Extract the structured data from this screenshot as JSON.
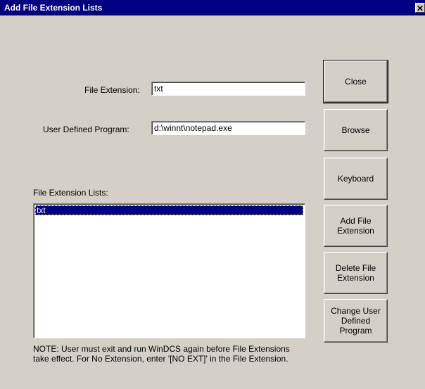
{
  "window": {
    "title": "Add File Extension Lists",
    "close_glyph": "✕"
  },
  "form": {
    "file_extension_label": "File Extension:",
    "file_extension_value": "txt",
    "program_label": "User Defined Program:",
    "program_value": "d:\\winnt\\notepad.exe",
    "list_label": "File Extension Lists:",
    "list_items": [
      "txt"
    ]
  },
  "buttons": {
    "close": "Close",
    "browse": "Browse",
    "keyboard": "Keyboard",
    "add": "Add File\nExtension",
    "delete": "Delete File\nExtension",
    "change": "Change User\nDefined Program"
  },
  "note": {
    "line1": "NOTE:  User must exit and run WinDCS again before File Extensions",
    "line2": "take effect. For No Extension, enter '[NO EXT]' in the File Extension."
  }
}
